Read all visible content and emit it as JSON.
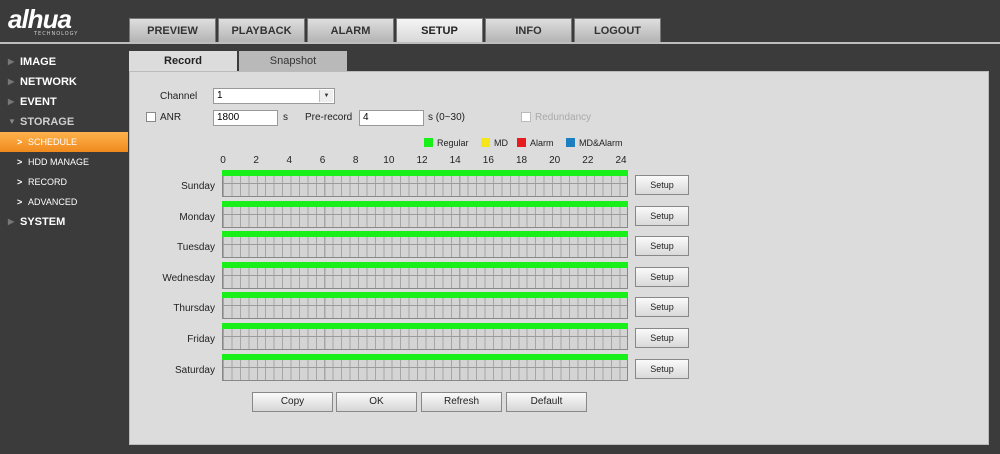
{
  "brand": {
    "name": "alhua",
    "sub": "TECHNOLOGY"
  },
  "topnav": [
    "PREVIEW",
    "PLAYBACK",
    "ALARM",
    "SETUP",
    "INFO",
    "LOGOUT"
  ],
  "topnav_active": "SETUP",
  "sidebar": {
    "items": [
      {
        "label": "IMAGE"
      },
      {
        "label": "NETWORK"
      },
      {
        "label": "EVENT"
      },
      {
        "label": "STORAGE"
      },
      {
        "label": "SCHEDULE"
      },
      {
        "label": "HDD MANAGE"
      },
      {
        "label": "RECORD"
      },
      {
        "label": "ADVANCED"
      },
      {
        "label": "SYSTEM"
      }
    ]
  },
  "subtabs": {
    "record": "Record",
    "snapshot": "Snapshot"
  },
  "form": {
    "channel_label": "Channel",
    "channel_value": "1",
    "anr_label": "ANR",
    "anr_value": "1800",
    "anr_unit": "s",
    "prerecord_label": "Pre-record",
    "prerecord_value": "4",
    "prerecord_unit": "s (0~30)",
    "redundancy_label": "Redundancy"
  },
  "legend": [
    {
      "label": "Regular",
      "color": "#19f019"
    },
    {
      "label": "MD",
      "color": "#f5e61a"
    },
    {
      "label": "Alarm",
      "color": "#e81c1c"
    },
    {
      "label": "MD&Alarm",
      "color": "#1e7fc0"
    }
  ],
  "axis_hours": [
    "0",
    "2",
    "4",
    "6",
    "8",
    "10",
    "12",
    "14",
    "16",
    "18",
    "20",
    "22",
    "24"
  ],
  "days": [
    {
      "label": "Sunday",
      "setup": "Setup",
      "regular": [
        0,
        24
      ]
    },
    {
      "label": "Monday",
      "setup": "Setup",
      "regular": [
        0,
        24
      ]
    },
    {
      "label": "Tuesday",
      "setup": "Setup",
      "regular": [
        0,
        24
      ]
    },
    {
      "label": "Wednesday",
      "setup": "Setup",
      "regular": [
        0,
        24
      ]
    },
    {
      "label": "Thursday",
      "setup": "Setup",
      "regular": [
        0,
        24
      ]
    },
    {
      "label": "Friday",
      "setup": "Setup",
      "regular": [
        0,
        24
      ]
    },
    {
      "label": "Saturday",
      "setup": "Setup",
      "regular": [
        0,
        24
      ]
    }
  ],
  "actions": {
    "copy": "Copy",
    "ok": "OK",
    "refresh": "Refresh",
    "default": "Default"
  }
}
